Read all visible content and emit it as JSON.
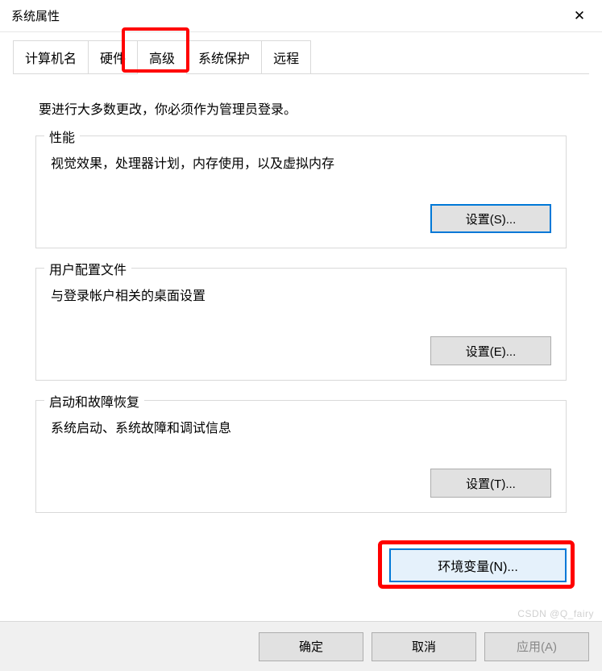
{
  "window": {
    "title": "系统属性"
  },
  "tabs": {
    "computer_name": "计算机名",
    "hardware": "硬件",
    "advanced": "高级",
    "system_protection": "系统保护",
    "remote": "远程"
  },
  "admin_notice": "要进行大多数更改，你必须作为管理员登录。",
  "performance": {
    "title": "性能",
    "desc": "视觉效果，处理器计划，内存使用，以及虚拟内存",
    "button": "设置(S)..."
  },
  "user_profiles": {
    "title": "用户配置文件",
    "desc": "与登录帐户相关的桌面设置",
    "button": "设置(E)..."
  },
  "startup": {
    "title": "启动和故障恢复",
    "desc": "系统启动、系统故障和调试信息",
    "button": "设置(T)..."
  },
  "env_button": "环境变量(N)...",
  "footer": {
    "ok": "确定",
    "cancel": "取消",
    "apply": "应用(A)"
  },
  "watermark": "CSDN @Q_fairy"
}
